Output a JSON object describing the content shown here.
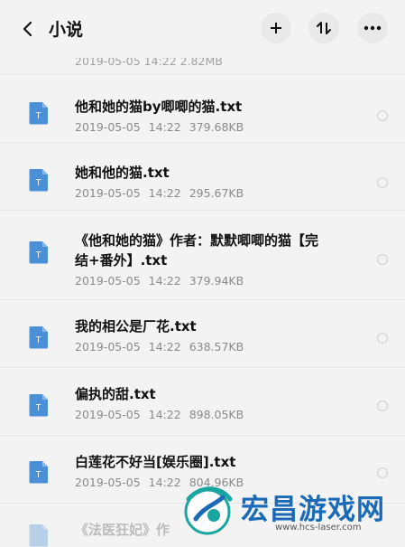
{
  "header": {
    "title": "小说",
    "add_icon": "plus-icon",
    "sort_icon": "sort-icon",
    "more_icon": "more-dots-icon"
  },
  "partial_top_row": {
    "meta": "2019-05-05  14:22  2.82MB"
  },
  "files": [
    {
      "name": "他和她的猫by唧唧的猫.txt",
      "date": "2019-05-05",
      "time": "14:22",
      "size": "379.68KB"
    },
    {
      "name": "她和他的猫.txt",
      "date": "2019-05-05",
      "time": "14:22",
      "size": "295.67KB"
    },
    {
      "name_line1": "《他和她的猫》作者：默默唧唧的猫【完",
      "name_line2": "结+番外】.txt",
      "date": "2019-05-05",
      "time": "14:22",
      "size": "379.94KB"
    },
    {
      "name": "我的相公是厂花.txt",
      "date": "2019-05-05",
      "time": "14:22",
      "size": "638.57KB"
    },
    {
      "name": "偏执的甜.txt",
      "date": "2019-05-05",
      "time": "14:22",
      "size": "898.05KB"
    },
    {
      "name": "白莲花不好当[娱乐圈].txt",
      "date": "2019-05-05",
      "time": "14:22",
      "size": "804.96KB"
    },
    {
      "name": "《法医狂妃》作"
    }
  ],
  "file_type_icon": "document-icon",
  "file_icon_letter": "T",
  "colors": {
    "accent": "#4a90d9",
    "background": "#f3f3f3",
    "meta_text": "#8a8a8a"
  },
  "watermark": {
    "name": "宏昌游戏网",
    "url": "www.hcs-laser.com"
  }
}
